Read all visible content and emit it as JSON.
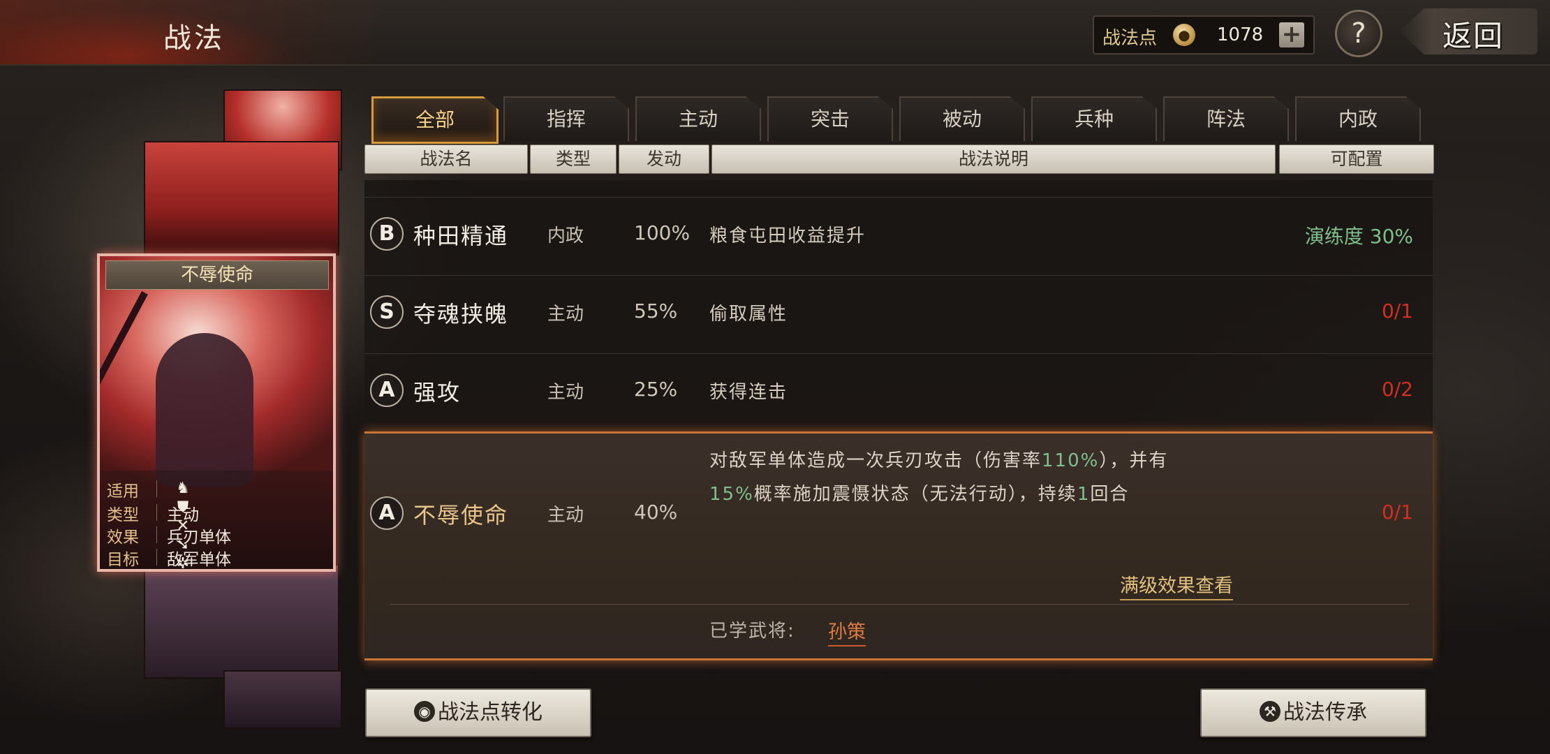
{
  "header": {
    "title": "战法",
    "points_label": "战法点",
    "points_value": "1078",
    "plus_label": "+",
    "help_label": "?",
    "back_label": "返回"
  },
  "tabs": [
    {
      "label": "全部",
      "active": true
    },
    {
      "label": "指挥"
    },
    {
      "label": "主动"
    },
    {
      "label": "突击"
    },
    {
      "label": "被动"
    },
    {
      "label": "兵种"
    },
    {
      "label": "阵法"
    },
    {
      "label": "内政"
    }
  ],
  "columns": [
    "战法名",
    "类型",
    "发动",
    "战法说明",
    "可配置"
  ],
  "skills": [
    {
      "grade": "B",
      "name": "种田精通",
      "type": "内政",
      "rate": "100%",
      "desc": "粮食屯田收益提升",
      "config": "演练度 30%",
      "config_color": "#7fc08b"
    },
    {
      "grade": "S",
      "name": "夺魂挟魄",
      "type": "主动",
      "rate": "55%",
      "desc": "偷取属性",
      "config": "0/1",
      "config_color": "#d42e23"
    },
    {
      "grade": "A",
      "name": "强攻",
      "type": "主动",
      "rate": "25%",
      "desc": "获得连击",
      "config": "0/2",
      "config_color": "#d42e23"
    }
  ],
  "selected_skill": {
    "grade": "A",
    "name": "不辱使命",
    "type": "主动",
    "rate": "40%",
    "config": "0/1",
    "desc_line1_a": "对敌军单体造成一次兵刃攻击（伤害率",
    "desc_line1_hl": "110%",
    "desc_line1_b": "），并有",
    "desc_line2_hl1": "15%",
    "desc_line2_a": "概率施加震慑状态（无法行动），持续",
    "desc_line2_hl2": "1",
    "desc_line2_b": "回合",
    "full_effect_link": "满级效果查看",
    "learned_label": "已学武将:",
    "learned_general": "孙策"
  },
  "card": {
    "title": "不辱使命",
    "apply_label": "适用",
    "apply_icons": [
      "cavalry-icon",
      "shield-icon",
      "bow-icon",
      "spear-icon",
      "siege-icon"
    ],
    "type_label": "类型",
    "type_value": "主动",
    "effect_label": "效果",
    "effect_value": "兵刃单体",
    "target_label": "目标",
    "target_value": "敌军单体"
  },
  "buttons": {
    "convert_label": "战法点转化",
    "inherit_label": "战法传承"
  },
  "colors": {
    "accent_gold": "#d79b3d",
    "highlight_green": "#7fc08b",
    "config_red": "#d42e23",
    "learned_orange": "#e07b3f"
  }
}
